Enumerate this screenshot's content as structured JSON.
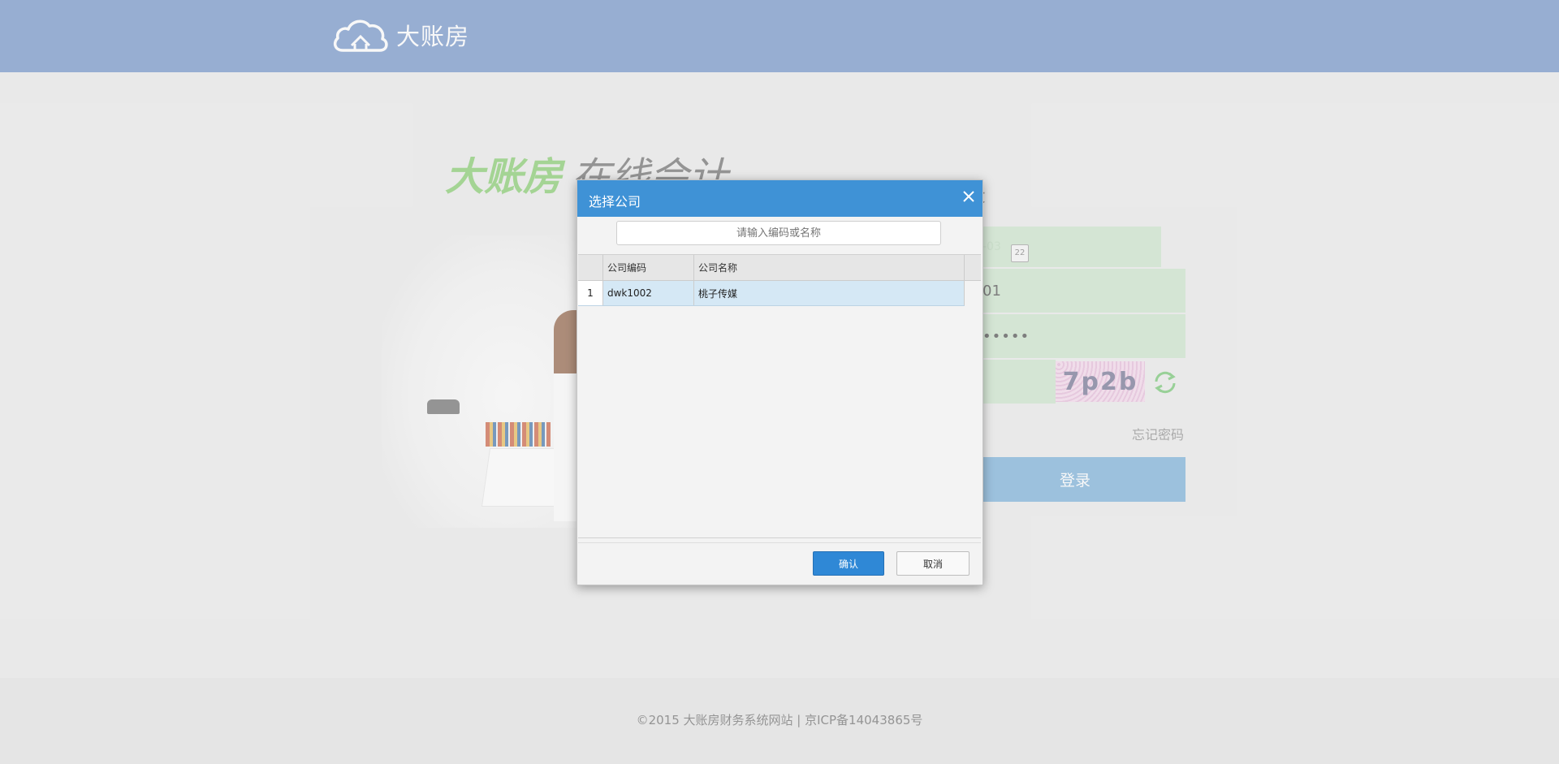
{
  "header": {
    "brand_name": "大账房",
    "logo_icon": "cloud-house-icon"
  },
  "hero": {
    "brand": "大账房",
    "subtitle": "在线会计"
  },
  "login": {
    "title_visible_fragment": "录",
    "date_value_fragment": "-03",
    "calendar_icon_text": "22",
    "account_value_fragment": "01",
    "password_mask": "•••••",
    "captcha_text": "7p2b",
    "refresh_icon": "refresh-icon",
    "forgot_password": "忘记密码",
    "login_button": "登录"
  },
  "footer": {
    "text": "©2015 大账房财务系统网站 | 京ICP备14043865号"
  },
  "dialog": {
    "title": "选择公司",
    "close_icon": "close-icon",
    "search_placeholder": "请输入编码或名称",
    "columns": {
      "code": "公司编码",
      "name": "公司名称"
    },
    "rows": [
      {
        "num": "1",
        "code": "dwk1002",
        "name": "桃子传媒"
      }
    ],
    "confirm": "确认",
    "cancel": "取消"
  },
  "colors": {
    "header_bg": "#6a8ec5",
    "dialog_header": "#3f92d6",
    "brand_green": "#7fc866",
    "selected_row": "#d5e8f5",
    "login_button": "#72abd6"
  }
}
